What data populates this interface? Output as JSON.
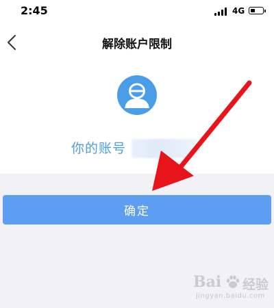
{
  "status_bar": {
    "time": "2:45",
    "network": "4G",
    "battery_level": 0.3
  },
  "nav": {
    "title": "解除账户限制",
    "back_icon": "chevron-left-icon"
  },
  "account": {
    "avatar_icon": "user-avatar-icon",
    "label": "你的账号",
    "label_color": "#4a9ee8"
  },
  "actions": {
    "confirm_label": "确定",
    "confirm_color": "#5d9ef2"
  },
  "annotation": {
    "arrow_color": "#e8141b"
  },
  "watermark": {
    "brand": "Bai",
    "product": "经验",
    "url": "jingyan.baidu.com"
  }
}
